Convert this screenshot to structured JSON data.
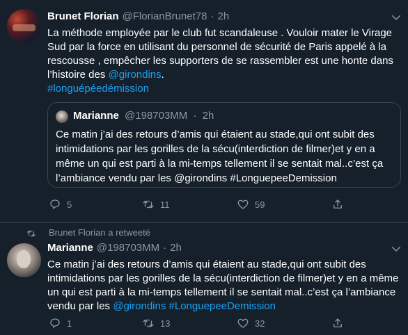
{
  "tweet1": {
    "author_name": "Brunet Florian",
    "author_handle": "@FlorianBrunet78",
    "separator": "·",
    "time": "2h",
    "text_line1": "La méthode employée par le club fut scandaleuse . Vouloir mater le Virage",
    "text_line2": "Sud par la force en utilisant du personnel de sécurité de Paris appelé à la",
    "text_line3": "rescousse , empêcher les supporters de se rassembler est une honte dans",
    "text_line4_prefix": "l’histoire des ",
    "mention": "@girondins",
    "text_line4_suffix": ".",
    "hashtag": "#longuépéedémission",
    "quoted": {
      "author_name": "Marianne",
      "author_handle": "@198703MM",
      "separator": "·",
      "time": "2h",
      "line1": "Ce matin j’ai des retours d’amis qui étaient au stade,qui ont subit des",
      "line2": "intimidations par les gorilles de la sécu(interdiction de filmer)et y en a",
      "line3": "même un qui est parti à la mi-temps tellement il se sentait mal..c’est ça",
      "line4": "l’ambiance vendu par les @girondins  #LonguepeeDemission"
    },
    "actions": {
      "replies": "5",
      "retweets": "11",
      "likes": "59"
    }
  },
  "retweet_label": "Brunet Florian a retweeté",
  "tweet2": {
    "author_name": "Marianne",
    "author_handle": "@198703MM",
    "separator": "·",
    "time": "2h",
    "line1": "Ce matin j’ai des retours d’amis qui étaient au stade,qui ont subit des",
    "line2": "intimidations par les gorilles de la sécu(interdiction de filmer)et y en a même",
    "line3": "un qui est parti à la mi-temps tellement il se sentait mal..c’est ça l’ambiance",
    "line4_prefix": "vendu par les ",
    "mention": "@girondins",
    "hashtag": "#LonguepeeDemission",
    "actions": {
      "replies": "1",
      "retweets": "13",
      "likes": "32"
    }
  },
  "colors": {
    "background": "#15202b",
    "accent": "#1da1f2",
    "muted": "#8899a6",
    "border": "#38444d"
  },
  "icons": [
    "chevron-down-icon",
    "reply-icon",
    "retweet-icon",
    "like-icon",
    "share-icon"
  ]
}
